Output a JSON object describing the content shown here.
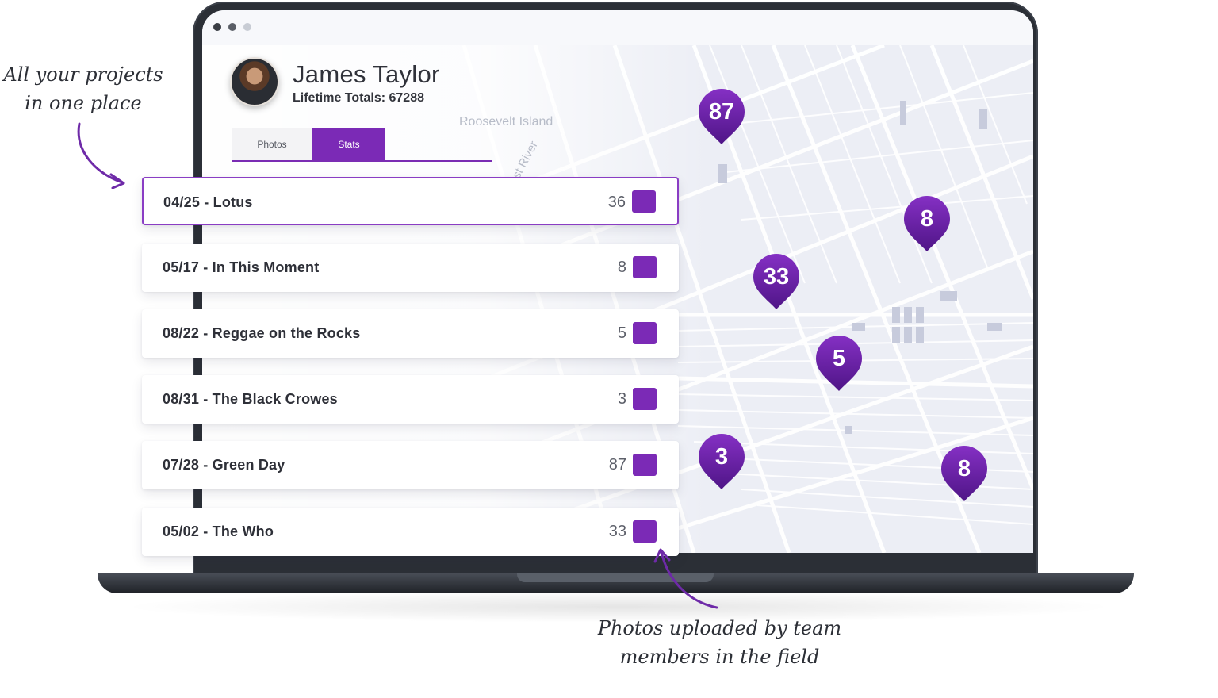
{
  "window": {
    "dots": [
      "#3a3d44",
      "#5a5e66",
      "#c8ccd4"
    ]
  },
  "profile": {
    "name": "James Taylor",
    "lifetime_totals": "Lifetime Totals: 67288"
  },
  "tabs": [
    {
      "label": "Photos",
      "active": false
    },
    {
      "label": "Stats",
      "active": true
    }
  ],
  "map": {
    "labels": [
      "Roosevelt Island",
      "st River"
    ]
  },
  "projects": [
    {
      "label": "04/25 - Lotus",
      "count": "36",
      "icon": "image-icon",
      "selected": true
    },
    {
      "label": "05/17 - In This Moment",
      "count": "8",
      "icon": "image-icon",
      "selected": false
    },
    {
      "label": "08/22 - Reggae on the Rocks",
      "count": "5",
      "icon": "image-icon",
      "selected": false
    },
    {
      "label": "08/31 - The Black Crowes",
      "count": "3",
      "icon": "image-icon",
      "selected": false
    },
    {
      "label": "07/28 - Green Day",
      "count": "87",
      "icon": "image-icon",
      "selected": false
    },
    {
      "label": "05/02 - The Who",
      "count": "33",
      "icon": "image-icon",
      "selected": false
    }
  ],
  "pins": [
    "87",
    "8",
    "33",
    "5",
    "3",
    "8"
  ],
  "annotations": {
    "projects": [
      "All your projects",
      "in one place"
    ],
    "photos": [
      "Photos uploaded by team",
      "members in the field"
    ]
  },
  "colors": {
    "accent": "#7b2ab6",
    "pin_top": "#7d2bbd",
    "pin_bottom": "#5a1894"
  }
}
